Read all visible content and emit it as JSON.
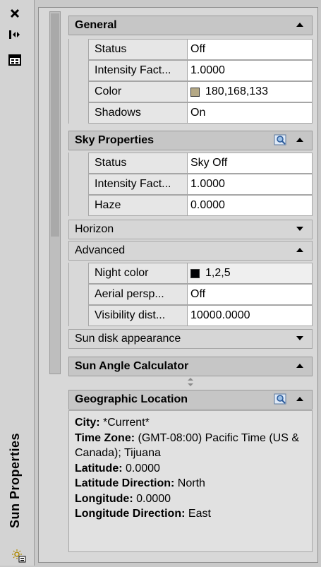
{
  "window": {
    "title": "Sun Properties"
  },
  "sections": {
    "general": {
      "title": "General",
      "rows": [
        {
          "name": "Status",
          "value": "Off"
        },
        {
          "name": "Intensity Fact...",
          "value": "1.0000"
        },
        {
          "name": "Color",
          "value": "180,168,133",
          "swatch": "#b4a885"
        },
        {
          "name": "Shadows",
          "value": "On"
        }
      ]
    },
    "sky": {
      "title": "Sky Properties",
      "rows": [
        {
          "name": "Status",
          "value": "Sky Off"
        },
        {
          "name": "Intensity Fact...",
          "value": "1.0000"
        },
        {
          "name": "Haze",
          "value": "0.0000"
        }
      ],
      "horizon": "Horizon",
      "advanced": "Advanced",
      "advanced_rows": [
        {
          "name": "Night color",
          "value": "1,2,5",
          "swatch": "#010205"
        },
        {
          "name": "Aerial persp...",
          "value": "Off"
        },
        {
          "name": "Visibility dist...",
          "value": "10000.0000"
        }
      ],
      "sun_disk": "Sun disk appearance"
    },
    "sun_angle": {
      "title": "Sun Angle Calculator"
    },
    "geo": {
      "title": "Geographic Location",
      "city_label": "City:",
      "city_value": "*Current*",
      "tz_label": "Time Zone:",
      "tz_value": "(GMT-08:00) Pacific Time (US & Canada); Tijuana",
      "lat_label": "Latitude:",
      "lat_value": "0.0000",
      "latdir_label": "Latitude Direction:",
      "latdir_value": "North",
      "lon_label": "Longitude:",
      "lon_value": "0.0000",
      "londir_label": "Longitude Direction:",
      "londir_value": "East"
    }
  },
  "icons": {
    "close": "close-icon",
    "autohide": "auto-hide-icon",
    "properties": "properties-icon",
    "magnifier": "magnifier-icon",
    "bottom": "sun-settings-icon"
  }
}
